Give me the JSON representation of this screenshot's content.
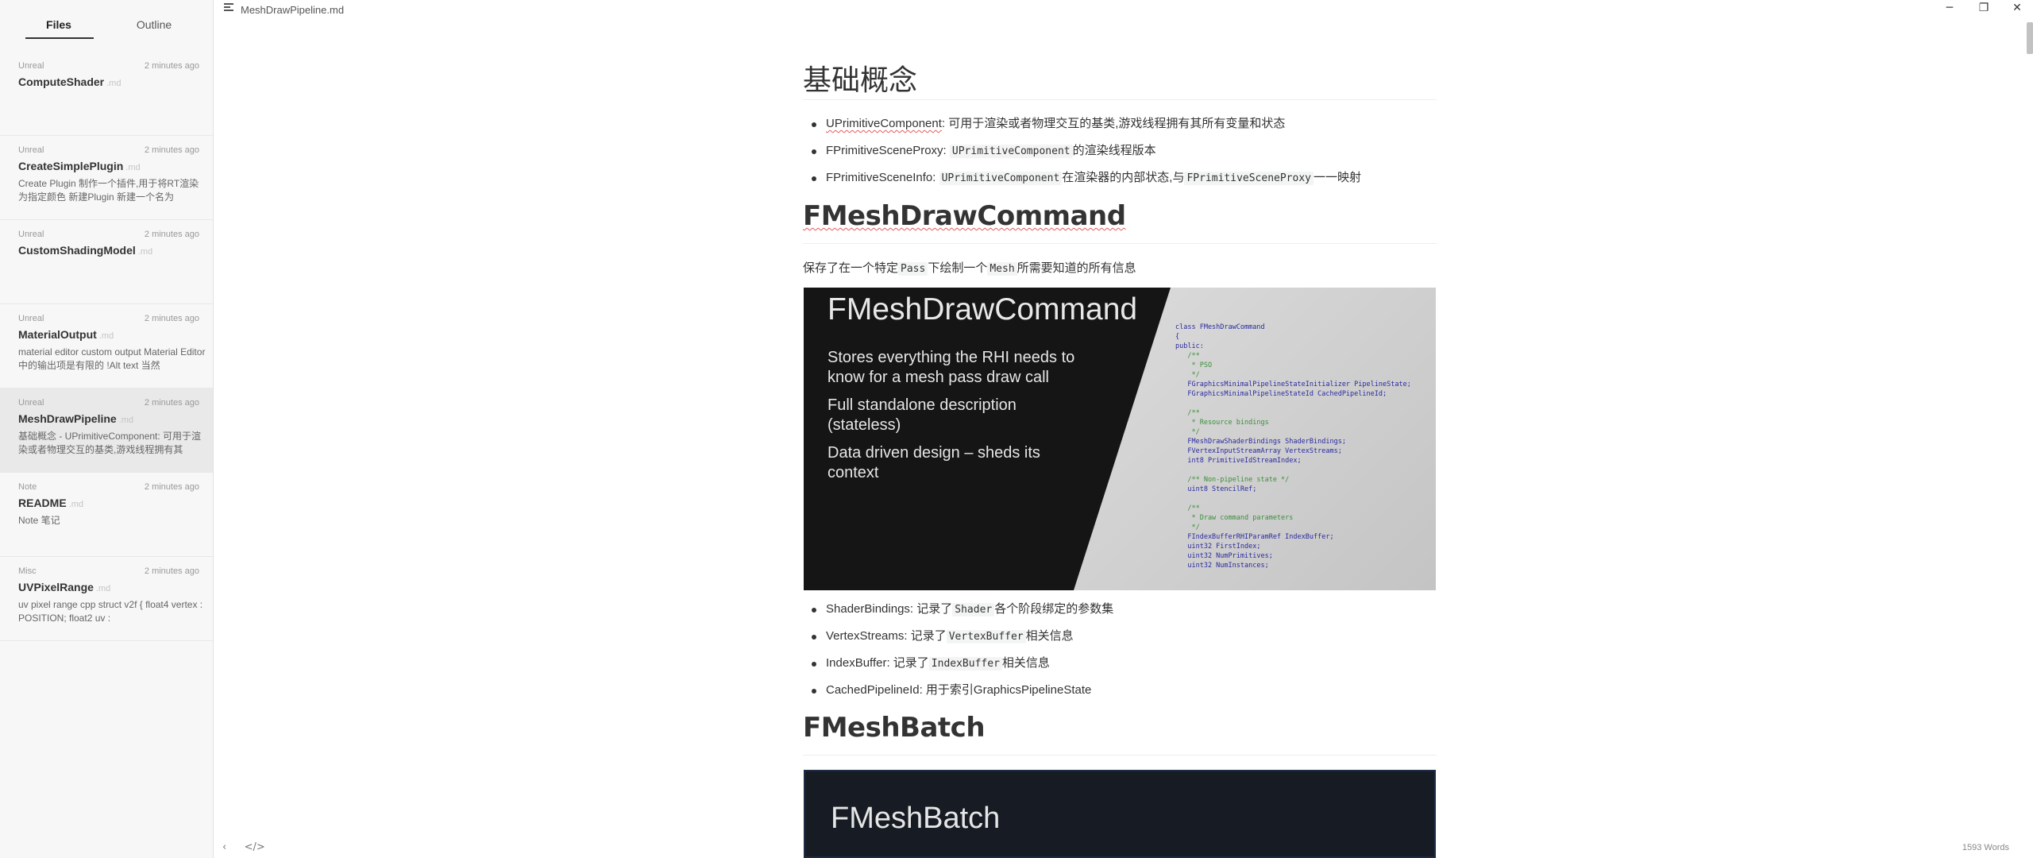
{
  "window": {
    "title": "MeshDrawPipeline.md",
    "minimize": "─",
    "maximize": "❐",
    "close": "✕"
  },
  "sidebar": {
    "tabs": [
      {
        "label": "Files",
        "active": true
      },
      {
        "label": "Outline",
        "active": false
      }
    ],
    "files": [
      {
        "folder": "Unreal",
        "time": "2 minutes ago",
        "title": "ComputeShader",
        "ext": ".md",
        "excerpt": ""
      },
      {
        "folder": "Unreal",
        "time": "2 minutes ago",
        "title": "CreateSimplePlugin",
        "ext": ".md",
        "excerpt": "Create Plugin 制作一个插件,用于将RT渲染为指定颜色 新建Plugin 新建一个名为"
      },
      {
        "folder": "Unreal",
        "time": "2 minutes ago",
        "title": "CustomShadingModel",
        "ext": ".md",
        "excerpt": ""
      },
      {
        "folder": "Unreal",
        "time": "2 minutes ago",
        "title": "MaterialOutput",
        "ext": ".md",
        "excerpt": "material editor custom output Material Editor中的输出项是有限的 !Alt text 当然"
      },
      {
        "folder": "Unreal",
        "time": "2 minutes ago",
        "title": "MeshDrawPipeline",
        "ext": ".md",
        "excerpt": "基础概念 - UPrimitiveComponent: 可用于渲染或者物理交互的基类,游戏线程拥有其",
        "active": true
      },
      {
        "folder": "Note",
        "time": "2 minutes ago",
        "title": "README",
        "ext": ".md",
        "excerpt": "Note 笔记"
      },
      {
        "folder": "Misc",
        "time": "2 minutes ago",
        "title": "UVPixelRange",
        "ext": ".md",
        "excerpt": "uv pixel range cpp struct v2f { float4 vertex : POSITION; float2 uv :"
      }
    ],
    "footer": {
      "collapse": "‹",
      "source": "</>"
    }
  },
  "doc": {
    "h1": "基础概念",
    "concepts": [
      {
        "name": "UPrimitiveComponent",
        "sep": ": ",
        "text": "可用于渲染或者物理交互的基类,游戏线程拥有其所有变量和状态"
      },
      {
        "name": "FPrimitiveSceneProxy",
        "sep": ": ",
        "code": "UPrimitiveComponent",
        "text": "的渲染线程版本"
      },
      {
        "name": "FPrimitiveSceneInfo",
        "sep": ": ",
        "code": "UPrimitiveComponent",
        "text": "在渲染器的内部状态,与",
        "code2": "FPrimitiveSceneProxy",
        "text2": "一一映射"
      }
    ],
    "h2_command": "FMeshDrawCommand",
    "command_para": {
      "a": "保存了在一个特定",
      "code1": "Pass",
      "b": "下绘制一个",
      "code2": "Mesh",
      "c": "所需要知道的所有信息"
    },
    "slide1": {
      "title": "FMeshDrawCommand",
      "bullets": [
        "Stores everything the RHI needs to know for a mesh pass draw call",
        "Full standalone description (stateless)",
        "Data driven design – sheds its context"
      ],
      "code_lines": [
        "class FMeshDrawCommand",
        "{",
        "public:",
        "   /**",
        "    * PSO",
        "    */",
        "   FGraphicsMinimalPipelineStateInitializer PipelineState;",
        "   FGraphicsMinimalPipelineStateId CachedPipelineId;",
        "",
        "   /**",
        "    * Resource bindings",
        "    */",
        "   FMeshDrawShaderBindings ShaderBindings;",
        "   FVertexInputStreamArray VertexStreams;",
        "   int8 PrimitiveIdStreamIndex;",
        "",
        "   /** Non-pipeline state */",
        "   uint8 StencilRef;",
        "",
        "   /**",
        "    * Draw command parameters",
        "    */",
        "   FIndexBufferRHIParamRef IndexBuffer;",
        "   uint32 FirstIndex;",
        "   uint32 NumPrimitives;",
        "   uint32 NumInstances;"
      ]
    },
    "fields": [
      {
        "name": "ShaderBindings",
        "a": ": 记录了",
        "code": "Shader",
        "b": "各个阶段绑定的参数集"
      },
      {
        "name": "VertexStreams",
        "a": ":  记录了",
        "code": "VertexBuffer",
        "b": "相关信息"
      },
      {
        "name": "IndexBuffer",
        "a": ":    记录了",
        "code": "IndexBuffer",
        "b": "相关信息"
      },
      {
        "name": "CachedPipelineId",
        "a": ": 用于索引GraphicsPipelineState",
        "code": "",
        "b": ""
      }
    ],
    "h2_batch": "FMeshBatch",
    "slide2": {
      "title": "FMeshBatch"
    }
  },
  "status": {
    "word_count": "1593 Words"
  }
}
